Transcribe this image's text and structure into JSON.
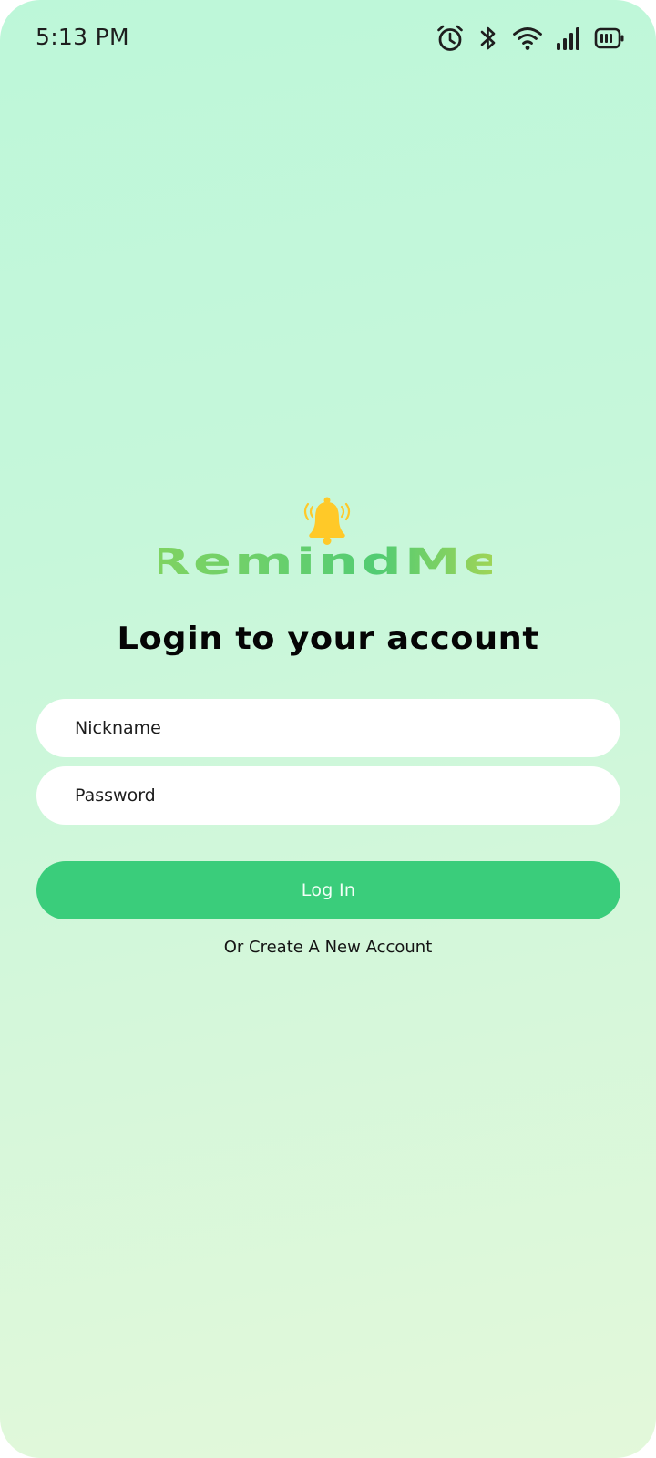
{
  "status_bar": {
    "time": "5:13 PM",
    "icons": [
      "alarm-icon",
      "bluetooth-icon",
      "wifi-icon",
      "signal-icon",
      "battery-icon"
    ]
  },
  "brand": {
    "name": "RemindMe",
    "logo_icon": "bell-icon",
    "bell_color": "#ffc928",
    "gradient": [
      "#8fd65a",
      "#52cc73",
      "#e6d43a"
    ]
  },
  "login": {
    "heading": "Login to your account",
    "nickname_placeholder": "Nickname",
    "nickname_value": "",
    "password_placeholder": "Password",
    "password_value": "",
    "login_button": "Log In",
    "create_account_link": "Or Create A New Account"
  },
  "colors": {
    "background_top": "#bdf7d9",
    "background_bottom": "#e3f8da",
    "accent": "#3acd7b",
    "field_bg": "#ffffff",
    "text": "#050505"
  }
}
